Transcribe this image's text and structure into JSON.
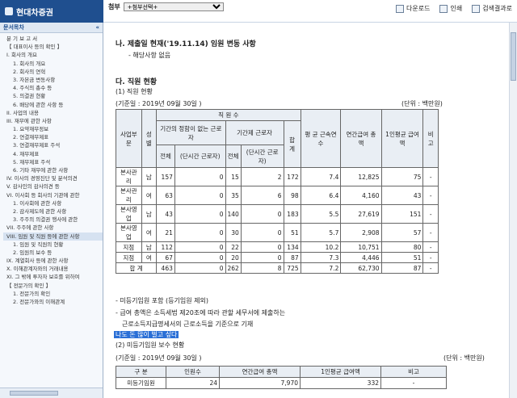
{
  "header": {
    "app_title": "현대차증권",
    "attach_label": "첨부",
    "attach_select": "+첨부선택+",
    "tools": [
      {
        "icon": "download-icon",
        "label": "다운로드"
      },
      {
        "icon": "print-icon",
        "label": "인쇄"
      },
      {
        "icon": "search-result-icon",
        "label": "검색결과로"
      }
    ]
  },
  "sidebar": {
    "title": "문서목차",
    "collapse": "«",
    "items": [
      {
        "label": "분 기 보 고 서",
        "level": 0
      },
      {
        "label": "【 대표이사 등의 확인 】",
        "level": 0
      },
      {
        "label": "I. 회사의 개요",
        "level": 0
      },
      {
        "label": "1. 회사의 개요",
        "level": 1
      },
      {
        "label": "2. 회사의 연혁",
        "level": 1
      },
      {
        "label": "3. 자본금 변동사항",
        "level": 1
      },
      {
        "label": "4. 주식의 총수 등",
        "level": 1
      },
      {
        "label": "5. 의결권 현황",
        "level": 1
      },
      {
        "label": "6. 배당에 관한 사항 등",
        "level": 1
      },
      {
        "label": "II. 사업의 내용",
        "level": 0
      },
      {
        "label": "III. 재무에 관한 사항",
        "level": 0
      },
      {
        "label": "1. 요약재무정보",
        "level": 1
      },
      {
        "label": "2. 연결재무제표",
        "level": 1
      },
      {
        "label": "3. 연결재무제표 주석",
        "level": 1
      },
      {
        "label": "4. 재무제표",
        "level": 1
      },
      {
        "label": "5. 재무제표 주석",
        "level": 1
      },
      {
        "label": "6. 기타 재무에 관한 사항",
        "level": 1
      },
      {
        "label": "IV. 이사의 경영진단 및 분석의견",
        "level": 0
      },
      {
        "label": "V. 감사인의 감사의견 등",
        "level": 0
      },
      {
        "label": "VI. 이사회 등 회사의 기관에 관한",
        "level": 0
      },
      {
        "label": "1. 이사회에 관한 사항",
        "level": 1
      },
      {
        "label": "2. 감사제도에 관한 사항",
        "level": 1
      },
      {
        "label": "3. 주주의 의결권 행사에 관한",
        "level": 1
      },
      {
        "label": "VII. 주주에 관한 사항",
        "level": 0
      },
      {
        "label": "VIII. 임원 및 직원 등에 관한 사항",
        "level": 0,
        "selected": true
      },
      {
        "label": "1. 임원 및 직원의 현황",
        "level": 1
      },
      {
        "label": "2. 임원의 보수 등",
        "level": 1
      },
      {
        "label": "IX. 계열회사 등에 관한 사항",
        "level": 0
      },
      {
        "label": "X. 이해관계자와의 거래내용",
        "level": 0
      },
      {
        "label": "XI. 그 밖에 투자자 보호를 위하여",
        "level": 0
      },
      {
        "label": "【 전문가의 확인 】",
        "level": 0
      },
      {
        "label": "1. 전문가의 확인",
        "level": 1
      },
      {
        "label": "2. 전문가와의 이해관계",
        "level": 1
      }
    ]
  },
  "doc": {
    "section_na": "나. 제출일 현재('19.11.14) 임원 변동 사항",
    "section_na_note": "- 해당사항 없음",
    "section_da": "다. 직원 현황",
    "sub1": "(1) 직원 현황",
    "basis1": "(기준일 :        2019년 09월 30일      )",
    "unit1": "(단위 : 백만원)",
    "t1_headers": {
      "dept": "사업부문",
      "sex": "성별",
      "staff": "직 원 수",
      "perm": "기간의 정함이 없는 근로자",
      "fixed": "기간제 근로자",
      "total_col": "합 계",
      "avg_years": "평 균 근속연수",
      "annual_pay": "연간급여 총 액",
      "per_capita": "1인평균 급여액",
      "note": "비고",
      "all": "전체",
      "part_time": "(단시간 근로자)"
    },
    "t1_rows": [
      [
        "본사관리",
        "남",
        "157",
        "0",
        "15",
        "2",
        "172",
        "7.4",
        "12,825",
        "75",
        "-"
      ],
      [
        "본사관리",
        "여",
        "63",
        "0",
        "35",
        "6",
        "98",
        "6.4",
        "4,160",
        "43",
        "-"
      ],
      [
        "본사영업",
        "남",
        "43",
        "0",
        "140",
        "0",
        "183",
        "5.5",
        "27,619",
        "151",
        "-"
      ],
      [
        "본사영업",
        "여",
        "21",
        "0",
        "30",
        "0",
        "51",
        "5.7",
        "2,908",
        "57",
        "-"
      ],
      [
        "지점",
        "남",
        "112",
        "0",
        "22",
        "0",
        "134",
        "10.2",
        "10,751",
        "80",
        "-"
      ],
      [
        "지점",
        "여",
        "67",
        "0",
        "20",
        "0",
        "87",
        "7.3",
        "4,446",
        "51",
        "-"
      ]
    ],
    "t1_total": [
      "합 계",
      "463",
      "0",
      "262",
      "8",
      "725",
      "7.2",
      "62,730",
      "87",
      "-"
    ],
    "notes": [
      "- 미등기임원 포함 (등기임원 제외)",
      "- 급여 총액은 소득세법 제20조에 따라 관할 세무서에 제출하는",
      "근로소득지급명세서의 근로소득을 기준으로 기재"
    ],
    "highlight": "나도 돈 많이 벌고 싶다",
    "sub2": "(2) 미등기임원 보수 현황",
    "basis2": "(기준일 :        2019년 09월 30일      )",
    "unit2": "(단위 : 백만원)",
    "t2_headers": [
      "구 분",
      "인원수",
      "연간급여 총액",
      "1인평균 급여액",
      "비고"
    ],
    "t2_row": [
      "미등기임원",
      "24",
      "7,970",
      "332",
      "-"
    ]
  }
}
